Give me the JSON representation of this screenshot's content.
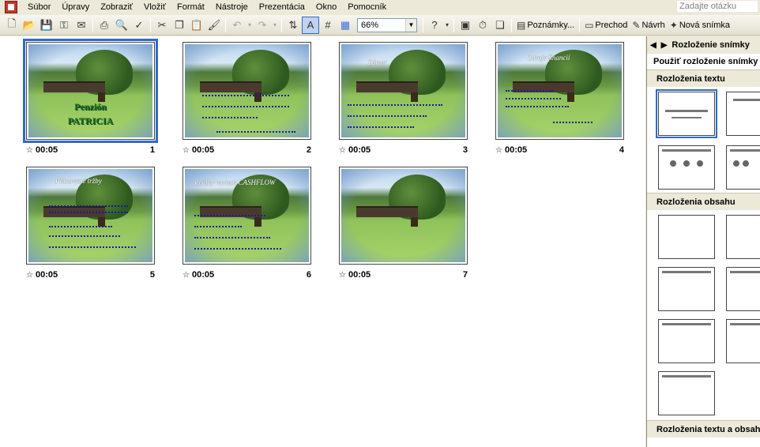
{
  "menu": {
    "items": [
      {
        "label": "Súbor",
        "name": "menu-subor"
      },
      {
        "label": "Úpravy",
        "name": "menu-upravy"
      },
      {
        "label": "Zobraziť",
        "name": "menu-zobrazit"
      },
      {
        "label": "Vložiť",
        "name": "menu-vlozit"
      },
      {
        "label": "Formát",
        "name": "menu-format"
      },
      {
        "label": "Nástroje",
        "name": "menu-nastroje"
      },
      {
        "label": "Prezentácia",
        "name": "menu-prezentacia"
      },
      {
        "label": "Okno",
        "name": "menu-okno"
      },
      {
        "label": "Pomocník",
        "name": "menu-pomocnik"
      }
    ],
    "help_placeholder": "Zadajte otázku"
  },
  "toolbar": {
    "zoom": "66%",
    "notes_label": "Poznámky...",
    "transition_label": "Prechod",
    "design_label": "Návrh",
    "new_slide_label": "Nová snímka"
  },
  "slides": [
    {
      "time": "00:05",
      "number": "1",
      "title": "",
      "pension": [
        "Penzión",
        "PATRICIA"
      ]
    },
    {
      "time": "00:05",
      "number": "2",
      "title": ""
    },
    {
      "time": "00:05",
      "number": "3",
      "title": "Zámer"
    },
    {
      "time": "00:05",
      "number": "4",
      "title": "Zdroje financií"
    },
    {
      "time": "00:05",
      "number": "5",
      "title": "Plánované tržby"
    },
    {
      "time": "00:05",
      "number": "6",
      "title": "Reálny variant CASHFLOW"
    },
    {
      "time": "00:05",
      "number": "7",
      "title": ""
    }
  ],
  "taskpane": {
    "title": "Rozloženie snímky",
    "apply_label": "Použiť rozloženie snímky",
    "section_text": "Rozloženia textu",
    "section_content": "Rozloženia obsahu",
    "section_text_content": "Rozloženia textu a obsahu"
  },
  "colors": {
    "selection": "#316ac5",
    "chrome": "#ece9d8"
  }
}
